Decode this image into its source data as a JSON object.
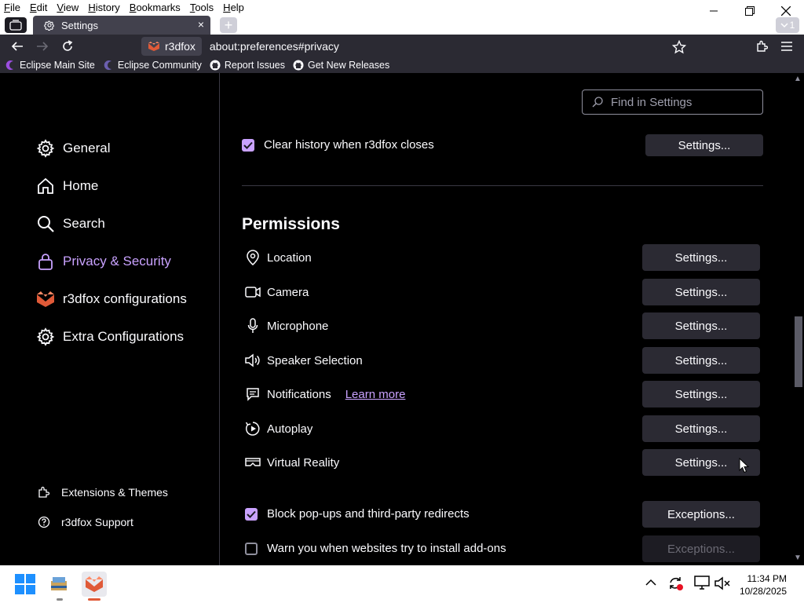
{
  "menu": {
    "items": [
      {
        "first": "F",
        "rest": "ile"
      },
      {
        "first": "E",
        "rest": "dit"
      },
      {
        "first": "V",
        "rest": "iew"
      },
      {
        "first": "H",
        "rest": "istory"
      },
      {
        "first": "B",
        "rest": "ookmarks"
      },
      {
        "first": "T",
        "rest": "ools"
      },
      {
        "first": "H",
        "rest": "elp"
      }
    ]
  },
  "tab": {
    "title": "Settings",
    "close": "×"
  },
  "new_tab": "+",
  "tab_count": "1",
  "urlbar": {
    "identity": "r3dfox",
    "url": "about:preferences#privacy"
  },
  "bookmarks": [
    "Eclipse Main Site",
    "Eclipse Community",
    "Report Issues",
    "Get New Releases"
  ],
  "search": {
    "placeholder": "Find in Settings"
  },
  "sidebar": {
    "categories": [
      {
        "label": "General",
        "icon": "gear-icon"
      },
      {
        "label": "Home",
        "icon": "home-icon"
      },
      {
        "label": "Search",
        "icon": "search-icon"
      },
      {
        "label": "Privacy & Security",
        "icon": "lock-icon",
        "selected": true
      },
      {
        "label": "r3dfox configurations",
        "icon": "r3dfox-logo-icon"
      },
      {
        "label": "Extra Configurations",
        "icon": "gear-icon"
      }
    ],
    "footer": [
      {
        "label": "Extensions & Themes",
        "icon": "puzzle-icon"
      },
      {
        "label": "r3dfox Support",
        "icon": "help-icon"
      }
    ]
  },
  "history": {
    "clear_label": "Clear history when r3dfox closes",
    "clear_checked": true,
    "settings_button": "Settings..."
  },
  "permissions": {
    "heading": "Permissions",
    "items": [
      {
        "label": "Location",
        "icon": "location-pin-icon",
        "button": "Settings..."
      },
      {
        "label": "Camera",
        "icon": "camera-icon",
        "button": "Settings..."
      },
      {
        "label": "Microphone",
        "icon": "microphone-icon",
        "button": "Settings..."
      },
      {
        "label": "Speaker Selection",
        "icon": "speaker-icon",
        "button": "Settings..."
      },
      {
        "label": "Notifications",
        "icon": "notification-icon",
        "button": "Settings...",
        "link": "Learn more"
      },
      {
        "label": "Autoplay",
        "icon": "autoplay-icon",
        "button": "Settings..."
      },
      {
        "label": "Virtual Reality",
        "icon": "vr-headset-icon",
        "button": "Settings..."
      }
    ],
    "popups": {
      "label": "Block pop-ups and third-party redirects",
      "checked": true,
      "button": "Exceptions..."
    },
    "addons": {
      "label": "Warn you when websites try to install add-ons",
      "checked": false,
      "button": "Exceptions...",
      "button_disabled": true
    }
  },
  "clock": {
    "time": "11:34 PM",
    "date": "10/28/2025"
  },
  "colors": {
    "accent": "#c9a2ff",
    "background": "#000000",
    "button": "#2b2a33",
    "toolbar": "#2b2a33"
  }
}
